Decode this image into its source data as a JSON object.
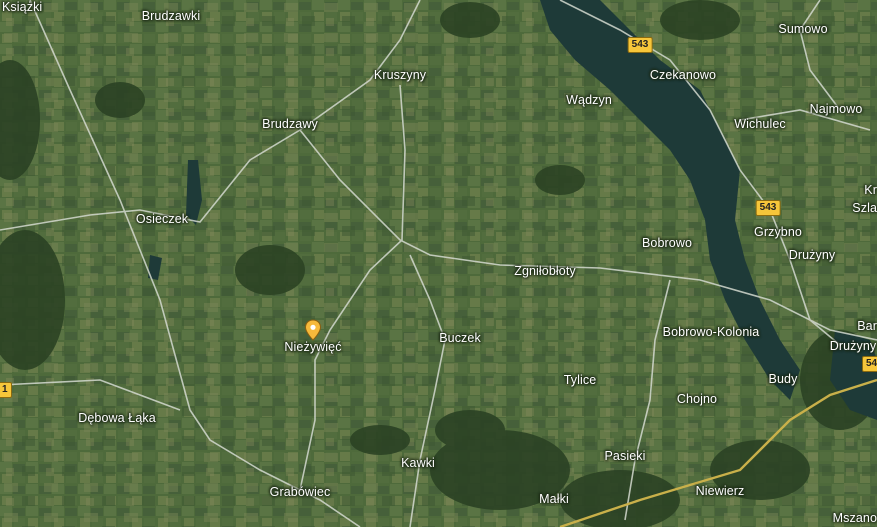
{
  "map": {
    "view": "satellite",
    "places": {
      "ksiazki": "Książki",
      "brudzawki": "Brudzawki",
      "kruszyny": "Kruszyny",
      "sumowo": "Sumowo",
      "czekanowo": "Czekanowo",
      "wadzyn": "Wądzyn",
      "najmowo": "Najmowo",
      "brudzawy": "Brudzawy",
      "wichulec": "Wichulec",
      "osieczek": "Osieczek",
      "grzybno": "Grzybno",
      "bobrowo": "Bobrowo",
      "druzyny_1": "Drużyny",
      "zgnilobloty": "Zgniłobłoty",
      "bobrowo_kolonia": "Bobrowo-Kolonia",
      "buczek": "Buczek",
      "niezywiec": "Nieżywięć",
      "druzyny_2": "Drużyny",
      "tylice": "Tylice",
      "budy": "Budy",
      "debowa_laka": "Dębowa Łąka",
      "chojno": "Chojno",
      "kawki": "Kawki",
      "pasieki": "Pasieki",
      "grabowiec": "Grabówiec",
      "niewierz": "Niewierz",
      "malki": "Małki",
      "mszano": "Mszano",
      "kr_partial": "Kr",
      "szla_partial": "Szla",
      "bar_partial": "Bar"
    },
    "road_shields": {
      "r543_north": "543",
      "r543_middle": "543",
      "r543_east_cut": "54",
      "r_west_cut": "1"
    },
    "pin": {
      "icon": "location-pin-icon",
      "color": "#f6b93b"
    },
    "colors": {
      "field": "#4f6b3c",
      "forest": "#2b4224",
      "water": "#1e3b3a",
      "road": "#d6dcd2",
      "highway": "#c9b04a"
    }
  }
}
